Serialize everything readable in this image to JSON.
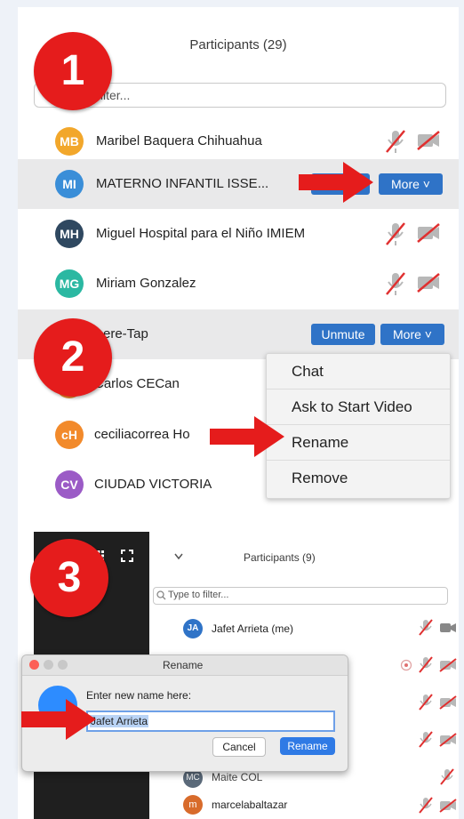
{
  "panel1": {
    "title": "Participants (29)",
    "filter_text": "filter...",
    "participants": [
      {
        "initials": "MB",
        "name": "Maribel Baquera Chihuahua",
        "color": "#f2a72b"
      },
      {
        "initials": "MI",
        "name": "MATERNO INFANTIL ISSE...",
        "color": "#3a8ed8",
        "more": "More"
      },
      {
        "initials": "MH",
        "name": "Miguel Hospital para el Niño IMIEM",
        "color": "#2f4860"
      },
      {
        "initials": "MG",
        "name": "Miriam Gonzalez",
        "color": "#2bb8a2"
      },
      {
        "initials": "",
        "name": "ere-Tap",
        "unmute": "Unmute",
        "more": "More"
      },
      {
        "initials": "",
        "name": "Carlos CECan",
        "color": "#f28a2b"
      },
      {
        "initials": "cH",
        "name": "ceciliacorrea Ho",
        "color": "#f28a2b"
      },
      {
        "initials": "CV",
        "name": "CIUDAD VICTORIA",
        "color": "#9b5bc6"
      }
    ]
  },
  "context_menu": [
    "Chat",
    "Ask to Start Video",
    "Rename",
    "Remove"
  ],
  "steps": [
    "1",
    "2",
    "3"
  ],
  "panel3": {
    "title": "Participants (9)",
    "filter_placeholder": "Type to filter...",
    "participants": [
      {
        "initials": "JA",
        "name": "Jafet Arrieta (me)",
        "color": "#2f73c7"
      },
      {
        "initials": "MC",
        "name": "Maite COL",
        "color": "#5b6a7a"
      },
      {
        "initials": "m",
        "name": "marcelabaltazar",
        "color": "#d86b2b"
      }
    ]
  },
  "dialog": {
    "title": "Rename",
    "prompt": "Enter new name here:",
    "value": "Jafet Arrieta",
    "cancel": "Cancel",
    "confirm": "Rename"
  }
}
